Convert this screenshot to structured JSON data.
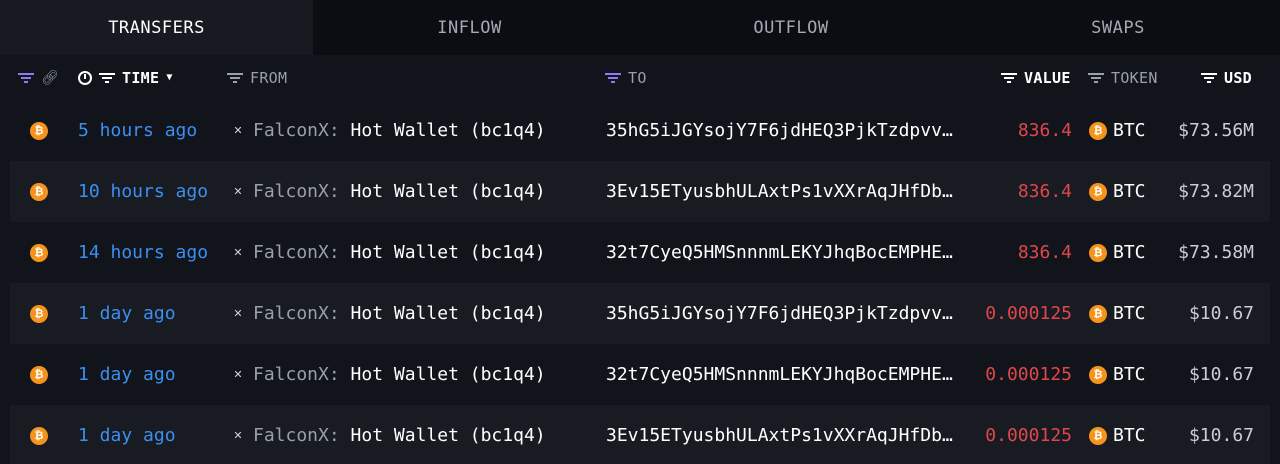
{
  "tabs": [
    {
      "label": "TRANSFERS",
      "active": true
    },
    {
      "label": "INFLOW",
      "active": false
    },
    {
      "label": "OUTFLOW",
      "active": false
    },
    {
      "label": "SWAPS",
      "active": false
    }
  ],
  "header": {
    "time": "TIME",
    "from": "FROM",
    "to": "TO",
    "value": "VALUE",
    "token": "TOKEN",
    "usd": "USD"
  },
  "rows": [
    {
      "time": "5 hours ago",
      "from_entity": "FalconX:",
      "from_wallet": "Hot Wallet (bc1q4)",
      "to": "35hG5iJGYsojY7F6jdHEQ3PjkTzdpvv…",
      "value": "836.4",
      "token": "BTC",
      "usd": "$73.56M"
    },
    {
      "time": "10 hours ago",
      "from_entity": "FalconX:",
      "from_wallet": "Hot Wallet (bc1q4)",
      "to": "3Ev15ETyusbhULAxtPs1vXXrAqJHfDb…",
      "value": "836.4",
      "token": "BTC",
      "usd": "$73.82M"
    },
    {
      "time": "14 hours ago",
      "from_entity": "FalconX:",
      "from_wallet": "Hot Wallet (bc1q4)",
      "to": "32t7CyeQ5HMSnnnmLEKYJhqBocEMPHE…",
      "value": "836.4",
      "token": "BTC",
      "usd": "$73.58M"
    },
    {
      "time": "1 day ago",
      "from_entity": "FalconX:",
      "from_wallet": "Hot Wallet (bc1q4)",
      "to": "35hG5iJGYsojY7F6jdHEQ3PjkTzdpvv…",
      "value": "0.000125",
      "token": "BTC",
      "usd": "$10.67"
    },
    {
      "time": "1 day ago",
      "from_entity": "FalconX:",
      "from_wallet": "Hot Wallet (bc1q4)",
      "to": "32t7CyeQ5HMSnnnmLEKYJhqBocEMPHE…",
      "value": "0.000125",
      "token": "BTC",
      "usd": "$10.67"
    },
    {
      "time": "1 day ago",
      "from_entity": "FalconX:",
      "from_wallet": "Hot Wallet (bc1q4)",
      "to": "3Ev15ETyusbhULAxtPs1vXXrAqJHfDb…",
      "value": "0.000125",
      "token": "BTC",
      "usd": "$10.67"
    }
  ],
  "colors": {
    "time_link": "#3b8ff0",
    "value_out": "#e0474c",
    "btc": "#f7931a"
  }
}
